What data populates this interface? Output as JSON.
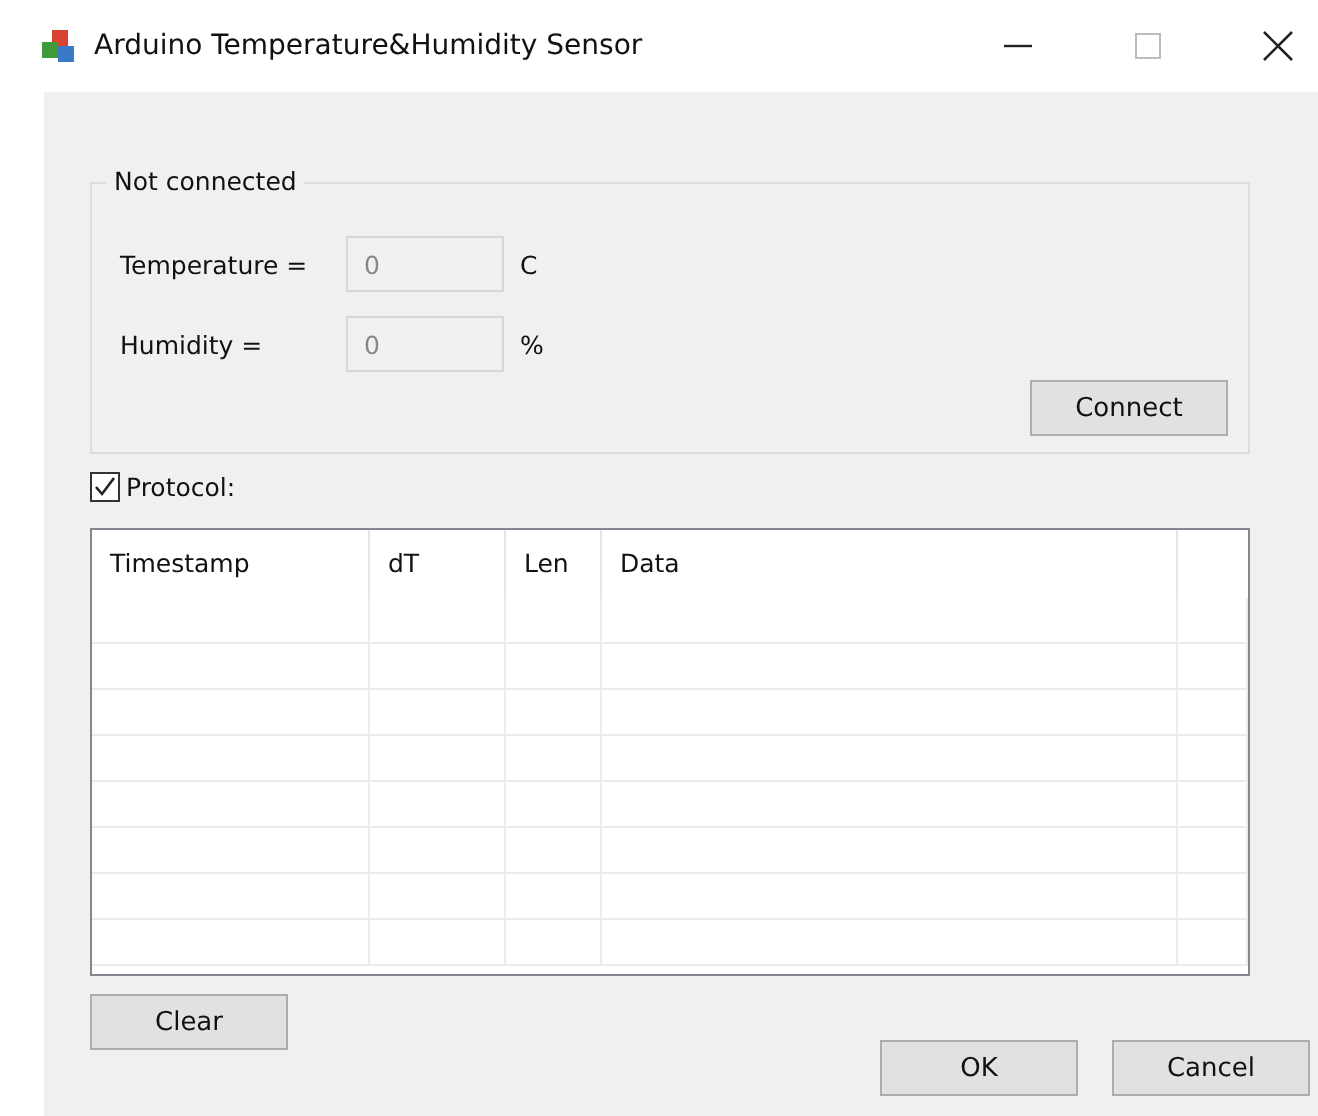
{
  "window": {
    "title": "Arduino Temperature&Humidity Sensor"
  },
  "status_group": {
    "title": "Not connected",
    "fields": [
      {
        "label": "Temperature =",
        "value": "0",
        "unit": "C",
        "disabled": true
      },
      {
        "label": "Humidity =",
        "value": "0",
        "unit": "%",
        "disabled": true
      }
    ],
    "connect_button": "Connect"
  },
  "protocol": {
    "label": "Protocol:",
    "checked": true
  },
  "table": {
    "columns": [
      "Timestamp",
      "dT",
      "Len",
      "Data"
    ]
  },
  "buttons": {
    "clear": "Clear",
    "ok": "OK",
    "cancel": "Cancel"
  }
}
